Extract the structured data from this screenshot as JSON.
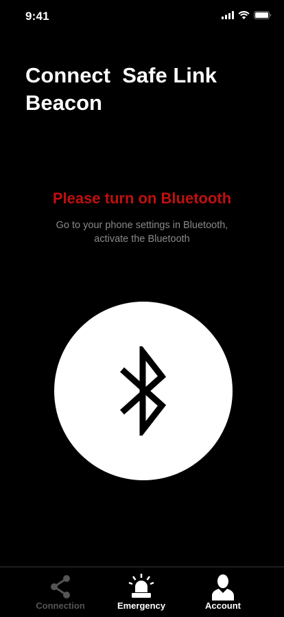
{
  "status_bar": {
    "time": "9:41",
    "icons": [
      "cellular-signal-icon",
      "wifi-icon",
      "battery-icon"
    ]
  },
  "title": "Connect  Safe Link\nBeacon",
  "prompt": {
    "heading": "Please turn on Bluetooth",
    "hint": "Go to your phone settings in Bluetooth, activate the Bluetooth",
    "color": "#c00f0f"
  },
  "bluetooth_button": {
    "icon": "bluetooth-icon"
  },
  "tab_bar": {
    "tabs": [
      {
        "label": "Connection",
        "icon": "connection-share-icon",
        "active": false
      },
      {
        "label": "Emergency",
        "icon": "siren-icon",
        "active": true
      },
      {
        "label": "Account",
        "icon": "user-icon",
        "active": true
      }
    ]
  }
}
